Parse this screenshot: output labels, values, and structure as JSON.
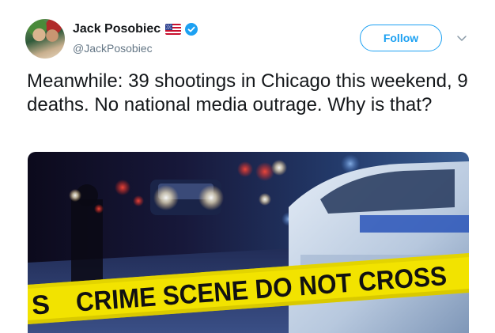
{
  "user": {
    "display_name": "Jack Posobiec",
    "handle": "@JackPosobiec",
    "avatar_icon": "profile-photo",
    "flag_icon": "us-flag-icon",
    "verified_icon": "verified-badge-icon"
  },
  "actions": {
    "follow_label": "Follow",
    "menu_icon": "chevron-down-icon"
  },
  "tweet": {
    "text": "Meanwhile: 39 shootings in Chicago this weekend, 9 deaths. No national media outrage. Why is that?"
  },
  "media": {
    "tape_text": "CRIME SCENE DO NOT CROSS",
    "tape_partial_text": "S"
  },
  "colors": {
    "accent": "#1da1f2",
    "text": "#14171a",
    "secondary_text": "#657786",
    "tape_yellow": "#f2e300"
  }
}
